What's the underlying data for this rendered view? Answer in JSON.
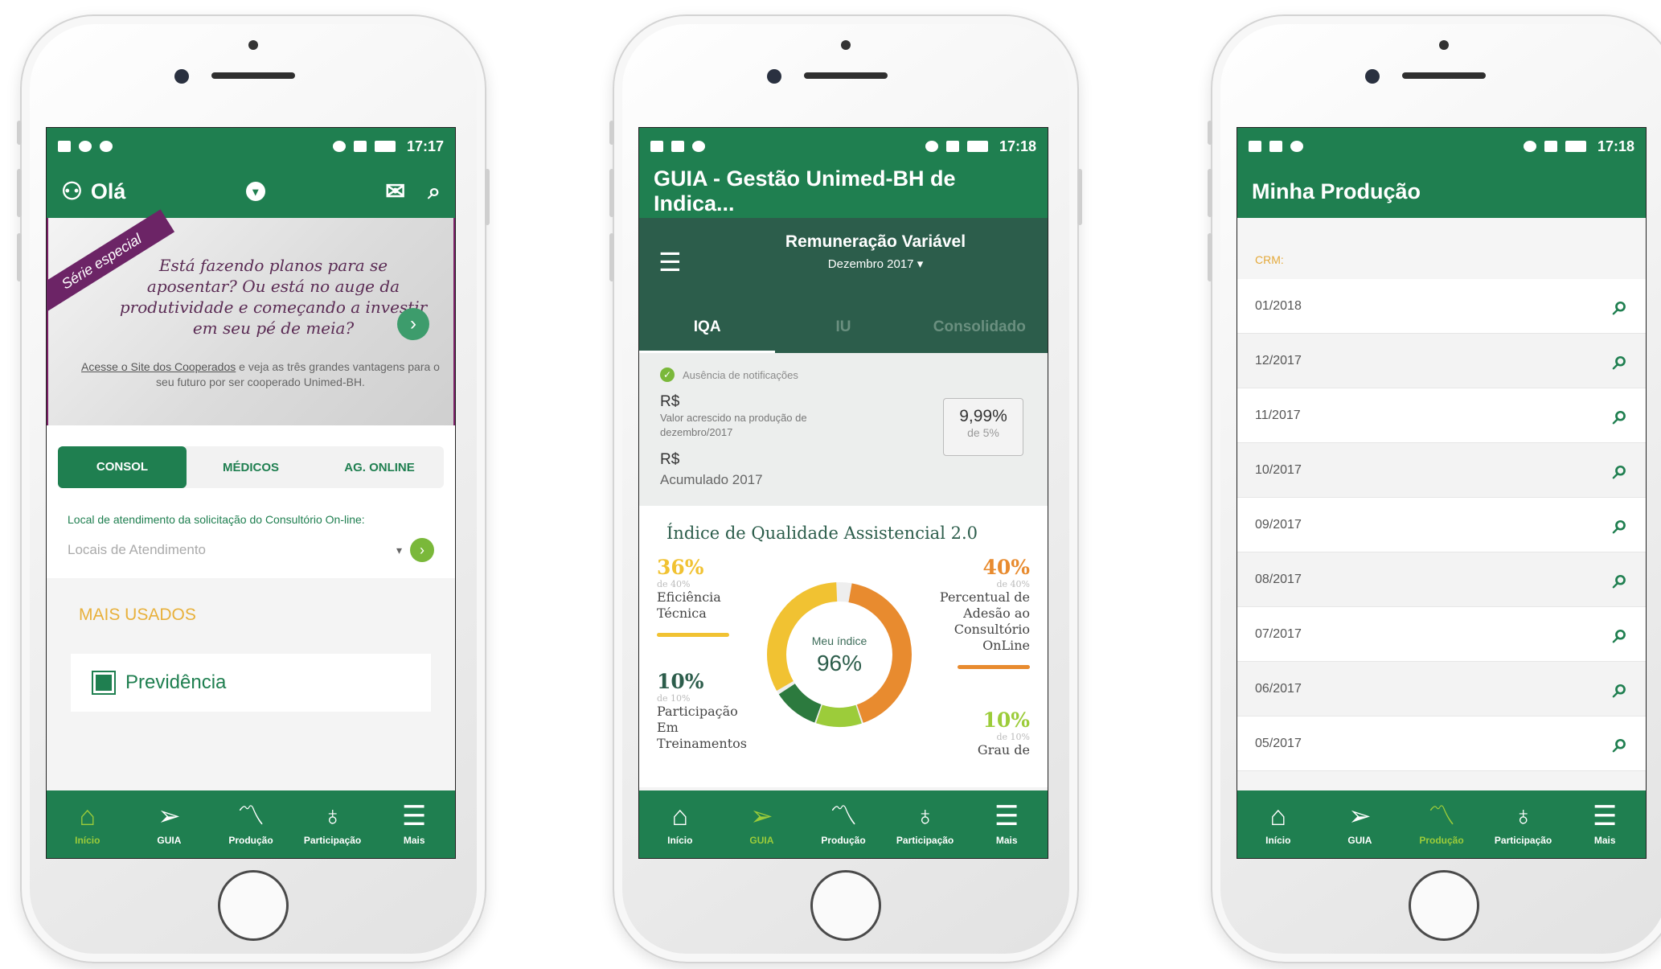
{
  "phone1": {
    "status_time": "17:17",
    "greeting": "Olá",
    "banner": {
      "ribbon": "Série especial",
      "headline": "Está fazendo planos para se aposentar? Ou está no auge da produtividade e começando a investir em seu pé de meia?",
      "link_text": "Acesse o Site dos Cooperados",
      "subtext": " e veja as três grandes vantagens para o seu futuro por ser cooperado Unimed-BH."
    },
    "tabs": [
      "CONSOL",
      "MÉDICOS",
      "AG. ONLINE"
    ],
    "location_label": "Local de atendimento da solicitação do Consultório On-line:",
    "location_placeholder": "Locais de Atendimento",
    "section_title": "MAIS USADOS",
    "first_item": "Previdência",
    "active_nav": "Início"
  },
  "phone2": {
    "status_time": "17:18",
    "title": "GUIA - Gestão Unimed-BH de Indica...",
    "subtitle": "Remuneração Variável",
    "month": "Dezembro 2017",
    "tabs": [
      "IQA",
      "IU",
      "Consolidado"
    ],
    "notification": "Ausência de notificações",
    "rs1": "R$",
    "rs1_desc": "Valor acrescido na produção de dezembro/2017",
    "percent_box": {
      "value": "9,99%",
      "of": "de 5%"
    },
    "rs2": "R$",
    "accumulated": "Acumulado 2017",
    "iqa_title": "Índice de Qualidade Assistencial 2.0",
    "metrics": {
      "m1": {
        "pct": "36%",
        "of": "de 40%",
        "label": "Eficiência Técnica",
        "color": "#f1c232"
      },
      "m2": {
        "pct": "10%",
        "of": "de 10%",
        "label": "Participação Em Treinamentos",
        "color": "#2c5d4b"
      },
      "m3": {
        "pct": "40%",
        "of": "de 40%",
        "label": "Percentual de Adesão ao Consultório OnLine",
        "color": "#e88b2f"
      },
      "m4": {
        "pct": "10%",
        "of": "de 10%",
        "label": "Grau de",
        "color": "#9ccc3a"
      }
    },
    "ring_label": "Meu índice",
    "ring_value": "96%",
    "active_nav": "GUIA"
  },
  "phone3": {
    "status_time": "17:18",
    "title": "Minha Produção",
    "crm_label": "CRM:",
    "months": [
      "01/2018",
      "12/2017",
      "11/2017",
      "10/2017",
      "09/2017",
      "08/2017",
      "07/2017",
      "06/2017",
      "05/2017"
    ],
    "active_nav": "Produção"
  },
  "nav": [
    {
      "label": "Início",
      "icon": "home-icon",
      "glyph": "⌂"
    },
    {
      "label": "GUIA",
      "icon": "navigation-arrow-icon",
      "glyph": "➢"
    },
    {
      "label": "Produção",
      "icon": "chart-line-icon",
      "glyph": "〽"
    },
    {
      "label": "Participação",
      "icon": "award-ribbon-icon",
      "glyph": "♁"
    },
    {
      "label": "Mais",
      "icon": "menu-icon",
      "glyph": "☰"
    }
  ],
  "colors": {
    "brand": "#1f7f50",
    "dark": "#2c5d4b",
    "accent_yellow": "#e8b03a",
    "accent_lime": "#9ccc3a"
  }
}
